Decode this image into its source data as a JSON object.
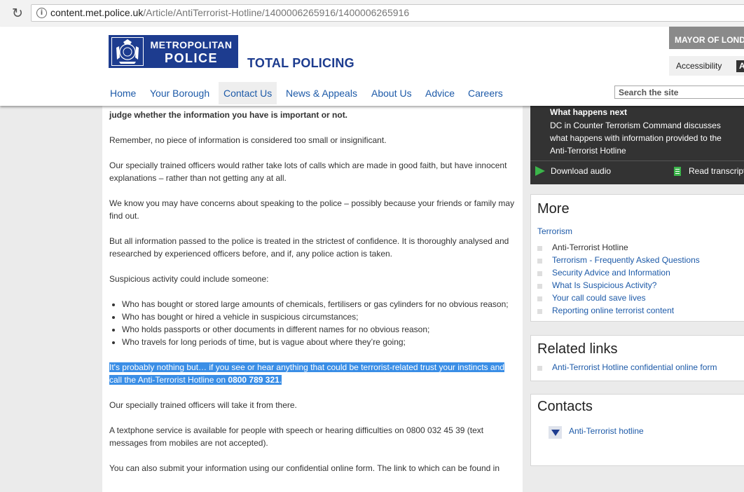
{
  "browser": {
    "url_domain": "content.met.police.uk",
    "url_path": "/Article/AntiTerrorist-Hotline/1400006265916/1400006265916"
  },
  "header": {
    "logo_line1": "METROPOLITAN",
    "logo_line2": "POLICE",
    "tagline": "TOTAL POLICING",
    "mayor": "MAYOR OF LONDON",
    "accessibility": "Accessibility",
    "text_size": "A",
    "search_placeholder": "Search the site",
    "nav": [
      "Home",
      "Your Borough",
      "Contact Us",
      "News & Appeals",
      "About Us",
      "Advice",
      "Careers"
    ]
  },
  "article": {
    "lead": "judge whether the information you have is important or not.",
    "p1": "Remember, no piece of information is considered too small or insignificant.",
    "p2": "Our specially trained officers would rather take lots of calls which are made in good faith, but have innocent explanations – rather than not getting any at all.",
    "p3": "We know you may have concerns about speaking to the police – possibly because your friends or family may find out.",
    "p4": "But all information passed to the police is treated in the strictest of confidence. It is thoroughly analysed and researched by experienced officers before, and if, any police action is taken.",
    "p5": "Suspicious activity could include someone:",
    "bullets": [
      "Who has bought or stored large amounts of chemicals, fertilisers or gas cylinders for no obvious reason;",
      "Who has bought or hired a vehicle in suspicious circumstances;",
      "Who holds passports or other documents in different names for no obvious reason;",
      "Who travels for long periods of time, but is vague about where they’re going;"
    ],
    "highlight_text": "It's probably nothing but… if you see or hear anything that could be terrorist-related trust your instincts and call the Anti-Terrorist Hotline on ",
    "hotline_number": "0800 789 321",
    "highlight_end": ".",
    "p6": "Our specially trained officers will take it from there.",
    "p7": "A textphone service is available for people with speech or hearing difficulties on 0800 032 45 39 (text messages from mobiles are not accepted).",
    "p8": "You can also submit your information using our confidential online form.  The link to which can be found in"
  },
  "media": {
    "title": "What happens next",
    "description": "DC in Counter Terrorism Command discusses what happens with information provided to the Anti-Terrorist Hotline",
    "download_audio": "Download audio",
    "read_transcript": "Read transcript"
  },
  "more": {
    "title": "More",
    "category": "Terrorism",
    "items": [
      {
        "label": "Anti-Terrorist Hotline",
        "is_link": false
      },
      {
        "label": "Terrorism - Frequently Asked Questions",
        "is_link": true
      },
      {
        "label": "Security Advice and Information",
        "is_link": true
      },
      {
        "label": "What Is Suspicious Activity?",
        "is_link": true
      },
      {
        "label": "Your call could save lives",
        "is_link": true
      },
      {
        "label": "Reporting online terrorist content",
        "is_link": true
      }
    ]
  },
  "related": {
    "title": "Related links",
    "items": [
      "Anti-Terrorist Hotline confidential online form"
    ]
  },
  "contacts": {
    "title": "Contacts",
    "item": "Anti-Terrorist hotline"
  },
  "colors": {
    "brand_blue": "#1d3c8f",
    "link_blue": "#1d5aa8",
    "highlight": "#3a8ee6",
    "media_bg": "#333333",
    "media_accent": "#3bb54a"
  }
}
